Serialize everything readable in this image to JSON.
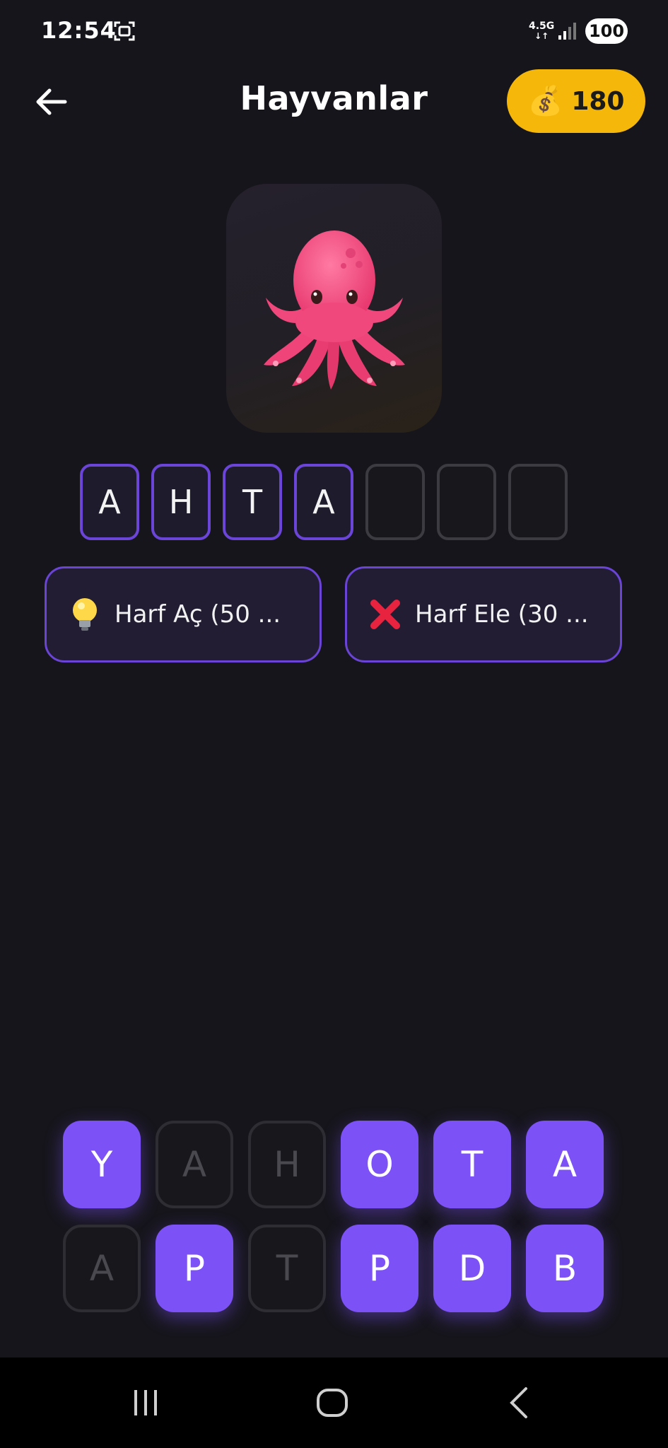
{
  "status_bar": {
    "time": "12:54",
    "network": "4.5G",
    "battery": "100"
  },
  "header": {
    "title": "Hayvanlar",
    "coins": "180",
    "coin_icon": "money-bag-icon",
    "back_icon": "arrow-left-icon"
  },
  "question": {
    "image": "octopus-emoji"
  },
  "answer": {
    "slots": [
      "A",
      "H",
      "T",
      "A",
      "",
      "",
      ""
    ]
  },
  "hints": {
    "reveal": {
      "icon": "light-bulb-icon",
      "label": "Harf Aç (50 ..."
    },
    "remove": {
      "icon": "cross-mark-icon",
      "label": "Harf Ele (30 ..."
    }
  },
  "keyboard": {
    "row1": [
      {
        "letter": "Y",
        "used": false
      },
      {
        "letter": "A",
        "used": true
      },
      {
        "letter": "H",
        "used": true
      },
      {
        "letter": "O",
        "used": false
      },
      {
        "letter": "T",
        "used": false
      },
      {
        "letter": "A",
        "used": false
      }
    ],
    "row2": [
      {
        "letter": "A",
        "used": true
      },
      {
        "letter": "P",
        "used": false
      },
      {
        "letter": "T",
        "used": true
      },
      {
        "letter": "P",
        "used": false
      },
      {
        "letter": "D",
        "used": false
      },
      {
        "letter": "B",
        "used": false
      }
    ]
  },
  "colors": {
    "accent": "#7c52f7",
    "coin_pill": "#f5b70a",
    "background": "#16151b"
  }
}
